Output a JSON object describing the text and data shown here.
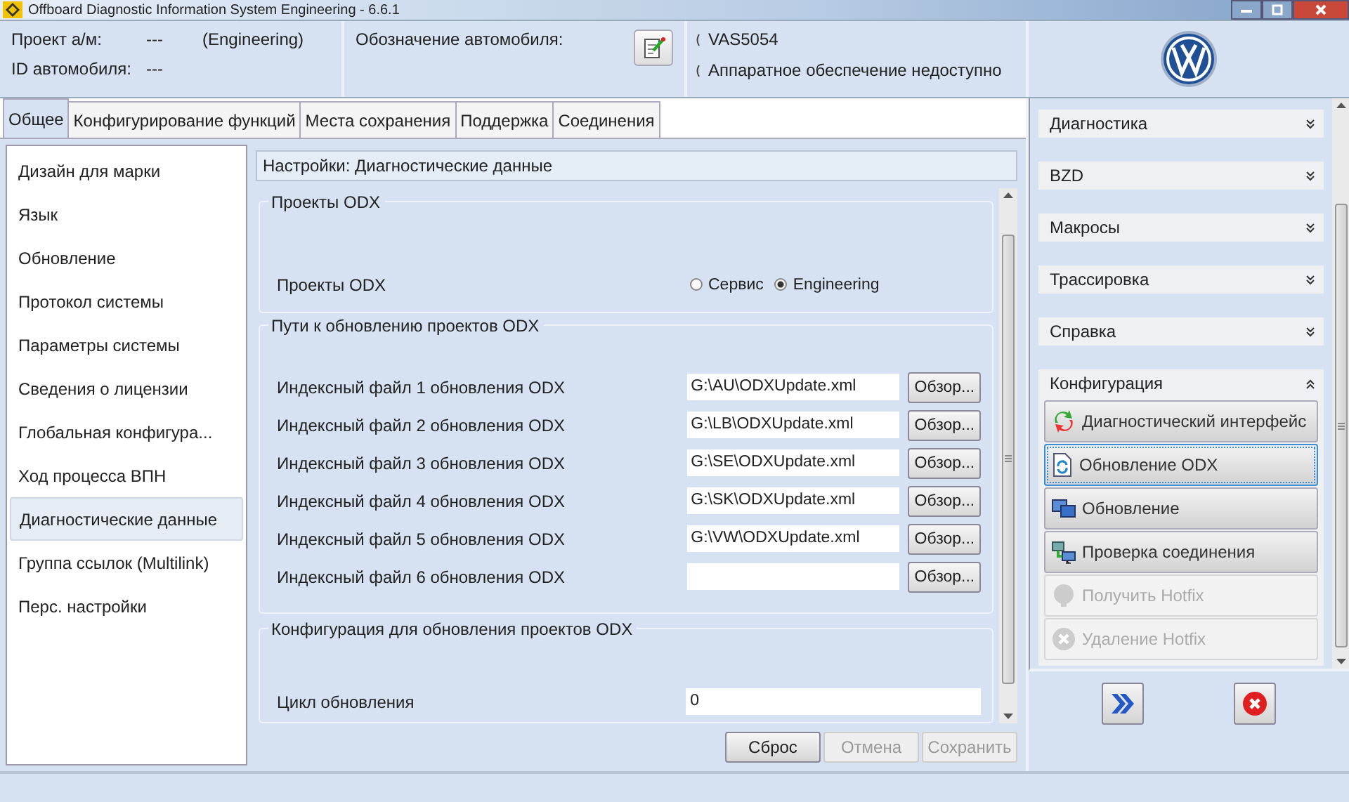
{
  "window": {
    "title": "Offboard Diagnostic Information System Engineering - 6.6.1"
  },
  "header": {
    "project_label": "Проект а/м:",
    "project_value": "---",
    "project_mode": "(Engineering)",
    "vehicle_id_label": "ID автомобиля:",
    "vehicle_id_value": "---",
    "designation_label": "Обозначение автомобиля:",
    "interface_lines": [
      "VAS5054",
      "Аппаратное обеспечение недоступно"
    ]
  },
  "tabs": [
    {
      "label": "Общее",
      "selected": true
    },
    {
      "label": "Конфигурирование функций",
      "selected": false
    },
    {
      "label": "Места сохранения",
      "selected": false
    },
    {
      "label": "Поддержка",
      "selected": false
    },
    {
      "label": "Соединения",
      "selected": false
    }
  ],
  "sidebar": {
    "items": [
      {
        "label": "Дизайн для марки",
        "selected": false
      },
      {
        "label": "Язык",
        "selected": false
      },
      {
        "label": "Обновление",
        "selected": false
      },
      {
        "label": "Протокол системы",
        "selected": false
      },
      {
        "label": "Параметры системы",
        "selected": false
      },
      {
        "label": "Сведения о лицензии",
        "selected": false
      },
      {
        "label": "Глобальная конфигура...",
        "selected": false
      },
      {
        "label": "Ход процесса ВПН",
        "selected": false
      },
      {
        "label": "Диагностические данные",
        "selected": true
      },
      {
        "label": "Группа ссылок (Multilink)",
        "selected": false
      },
      {
        "label": "Перс. настройки",
        "selected": false
      }
    ]
  },
  "content": {
    "title": "Настройки: Диагностические данные",
    "projects": {
      "legend": "Проекты ODX",
      "label": "Проекты ODX",
      "options": [
        {
          "label": "Сервис",
          "selected": false
        },
        {
          "label": "Engineering",
          "selected": true
        }
      ]
    },
    "paths": {
      "legend": "Пути к обновлению проектов ODX",
      "rows": [
        {
          "label": "Индексный файл 1 обновления ODX",
          "value": "G:\\AU\\ODXUpdate.xml",
          "button": "Обзор..."
        },
        {
          "label": "Индексный файл 2 обновления ODX",
          "value": "G:\\LB\\ODXUpdate.xml",
          "button": "Обзор..."
        },
        {
          "label": "Индексный файл 3 обновления ODX",
          "value": "G:\\SE\\ODXUpdate.xml",
          "button": "Обзор..."
        },
        {
          "label": "Индексный файл 4 обновления ODX",
          "value": "G:\\SK\\ODXUpdate.xml",
          "button": "Обзор..."
        },
        {
          "label": "Индексный файл 5 обновления ODX",
          "value": "G:\\VW\\ODXUpdate.xml",
          "button": "Обзор..."
        },
        {
          "label": "Индексный файл 6 обновления ODX",
          "button": "Обзор..."
        }
      ]
    },
    "update_config": {
      "legend": "Конфигурация для обновления проектов ODX",
      "label": "Цикл обновления",
      "value": "0"
    },
    "buttons": [
      {
        "label": "Сброс",
        "disabled": false
      },
      {
        "label": "Отмена",
        "disabled": true
      },
      {
        "label": "Сохранить",
        "disabled": true
      }
    ]
  },
  "right_panel": {
    "groups": [
      {
        "label": "Диагностика",
        "expanded": false
      },
      {
        "label": "BZD",
        "expanded": false
      },
      {
        "label": "Макросы",
        "expanded": false
      },
      {
        "label": "Трассировка",
        "expanded": false
      },
      {
        "label": "Справка",
        "expanded": false
      },
      {
        "label": "Конфигурация",
        "expanded": true
      }
    ],
    "actions": [
      {
        "label": "Диагностический интерфейс",
        "kind": "interface",
        "disabled": false,
        "selected": false
      },
      {
        "label": "Обновление ODX",
        "kind": "odx",
        "disabled": false,
        "selected": true
      },
      {
        "label": "Обновление",
        "kind": "update",
        "disabled": false,
        "selected": false
      },
      {
        "label": "Проверка соединения",
        "kind": "network",
        "disabled": false,
        "selected": false
      },
      {
        "label": "Получить Hotfix",
        "kind": "get",
        "disabled": true,
        "selected": false
      },
      {
        "label": "Удаление Hotfix",
        "kind": "delete",
        "disabled": true,
        "selected": false
      }
    ]
  }
}
